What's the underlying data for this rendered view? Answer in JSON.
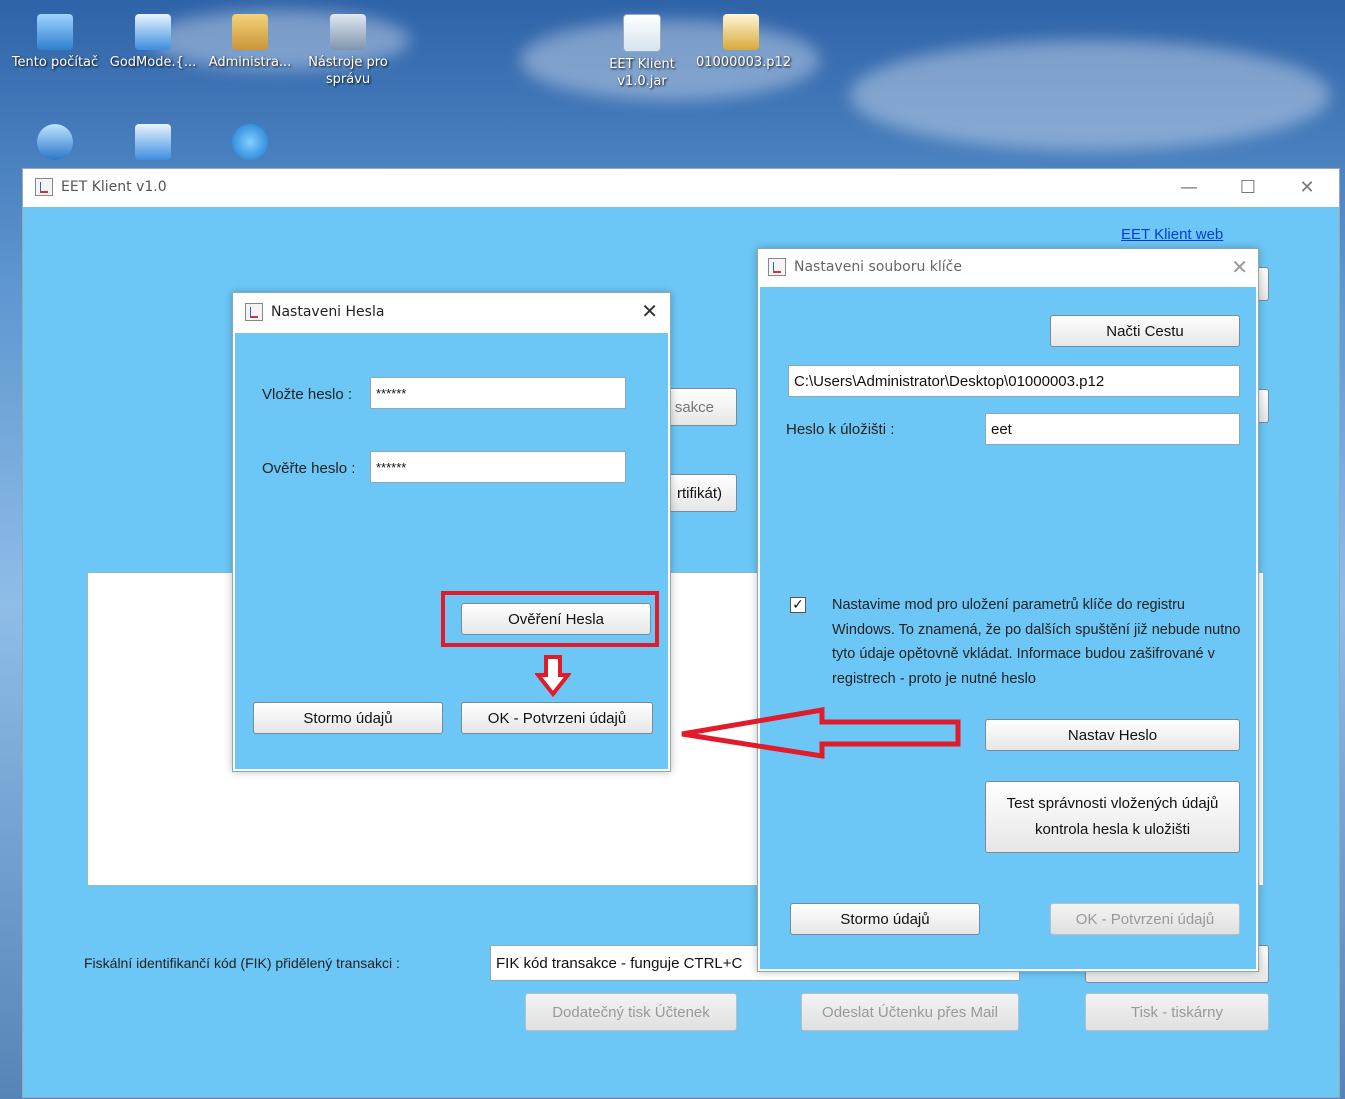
{
  "desktop": {
    "icons": [
      {
        "label": "Tento počítač",
        "icon": "computer-icon"
      },
      {
        "label": "GodMode.{...",
        "icon": "control-panel-icon"
      },
      {
        "label": "Administra...",
        "icon": "user-folder-icon"
      },
      {
        "label": "Nástroje pro správu",
        "icon": "admin-tools-icon"
      },
      {
        "label": "EET Klient v1.0.jar",
        "icon": "java-jar-icon"
      },
      {
        "label": "01000003.p12",
        "icon": "certificate-icon"
      },
      {
        "label": "",
        "icon": "network-icon"
      },
      {
        "label": "",
        "icon": "control-panel-icon"
      },
      {
        "label": "",
        "icon": "internet-explorer-icon"
      }
    ]
  },
  "main_window": {
    "title": "EET Klient v1.0",
    "web_link": "EET Klient web",
    "partial_button_1": "sakce",
    "partial_button_2": "rtifikát)",
    "fik_label": "Fiskální identifikančí kód (FIK) přidělený transakci :",
    "fik_value": "FIK kód transakce - funguje CTRL+C",
    "btn_reprint": "Dodatečný tisk Účtenek",
    "btn_send_mail": "Odeslat Účtenku přes Mail",
    "btn_print": "Tisk - tiskárny"
  },
  "password_dialog": {
    "title": "Nastaveni Hesla",
    "label_enter": "Vložte heslo :",
    "value_enter": "******",
    "label_verify": "Ověřte heslo :",
    "value_verify": "******",
    "btn_verify": "Ověření Hesla",
    "btn_cancel": "Stormo údajů",
    "btn_ok": "OK - Potvrzeni údajů"
  },
  "key_dialog": {
    "title": "Nastaveni souboru klíče",
    "btn_load_path": "Načti Cestu",
    "path_value": "C:\\Users\\Administrator\\Desktop\\01000003.p12",
    "label_store_pwd": "Heslo k úložišti :",
    "store_pwd_value": "eet",
    "checkbox_checked": true,
    "checkbox_text": "Nastavime mod pro uložení parametrů klíče do registru Windows. To znamená, že po dalších spuštění již nebude nutno tyto údaje opětovně vkládat. Informace budou zašifrované v registrech - proto je nutné heslo",
    "btn_set_password": "Nastav Heslo",
    "btn_test_line1": "Test správnosti vložených údajů",
    "btn_test_line2": "kontrola hesla k uložišti",
    "btn_cancel": "Stormo údajů",
    "btn_ok": "OK - Potvrzeni údajů"
  },
  "colors": {
    "client_bg": "#6cc7f7",
    "annotation_red": "#e21b2b",
    "link_blue": "#0b3bd6"
  }
}
